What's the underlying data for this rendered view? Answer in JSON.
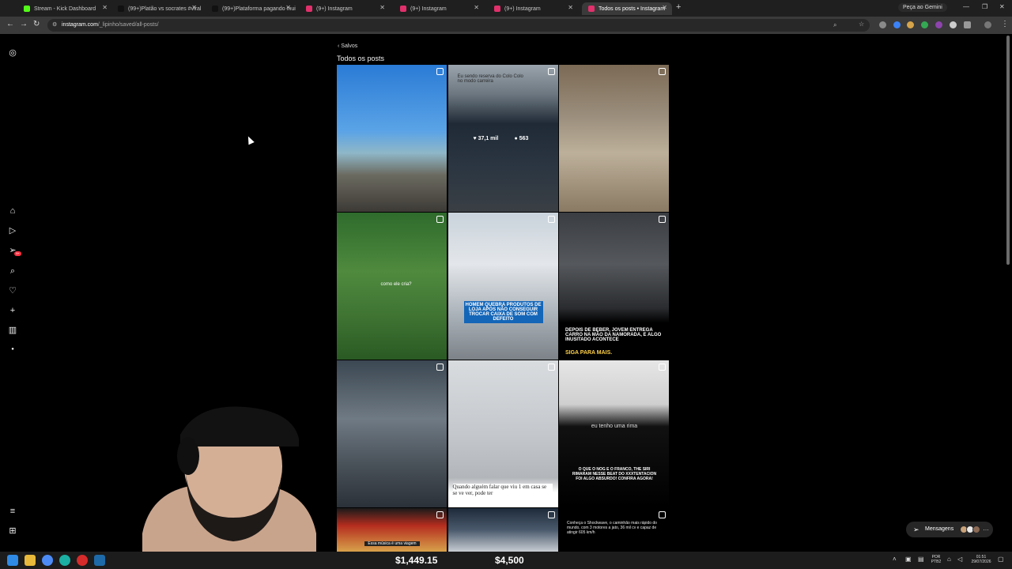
{
  "browser": {
    "tabs": [
      {
        "label": "Stream - Kick Dashboard",
        "color": "#53fc18",
        "active": false
      },
      {
        "label": "(99+)Platão vs socrates #viral #",
        "color": "#111111",
        "active": false
      },
      {
        "label": "(99+)Plataforma pagando muit",
        "color": "#111111",
        "active": false
      },
      {
        "label": "(9+) Instagram",
        "color": "#e1306c",
        "active": false
      },
      {
        "label": "(9+) Instagram",
        "color": "#e1306c",
        "active": false
      },
      {
        "label": "(9+) Instagram",
        "color": "#e1306c",
        "active": false
      },
      {
        "label": "Todos os posts • Instagram",
        "color": "#e1306c",
        "active": true
      }
    ],
    "gemini_label": "Peça ao Gemini",
    "url_host": "instagram.com",
    "url_path": "/_lipinho/saved/all-posts/"
  },
  "instagram": {
    "back_label": "Salvos",
    "page_title": "Todos os posts",
    "notification_badge": "9+",
    "posts": [
      {
        "bg": "linear-gradient(180deg,#2a7bd6 0%,#5aa3e6 45%,#8fb7c8 60%,#6b6a60 75%,#3d3a35 100%)",
        "caption": ""
      },
      {
        "bg": "linear-gradient(180deg,#9aa4ad 0%,#6c7780 20%,#1f2a36 40%,#2b3642 70%,#3a3f44 100%)",
        "caption": "Eu sendo reserva do Colo Colo no modo carreira",
        "likes": "37,1 mil",
        "comments": "563"
      },
      {
        "bg": "linear-gradient(180deg,#7b6a55 0%,#9b8e7c 35%,#bdb09a 60%,#8a7a63 100%)",
        "caption": ""
      },
      {
        "bg": "linear-gradient(180deg,#2f6b2c 0%,#4f8a3e 40%,#3f7433 70%,#2a5a23 100%)",
        "caption": "como ele cria?"
      },
      {
        "bg": "linear-gradient(180deg,#c9d3db 0%,#e3e6ea 35%,#a9b1b8 70%,#7c8288 100%)",
        "caption": "HOMEM QUEBRA PRODUTOS DE LOJA APÓS NÃO CONSEGUIR TROCAR CAIXA DE SOM COM DEFEITO"
      },
      {
        "bg": "linear-gradient(180deg,#3a3d42 0%,#55585c 35%,#2a2c2f 65%,#000000 75%,#000000 100%)",
        "caption": "DEPOIS DE BEBER, JOVEM ENTREGA CARRO NA MÃO DA NAMORADA, E ALGO INUSITADO ACONTECE",
        "caption2": "SIGA PARA MAIS."
      },
      {
        "bg": "linear-gradient(180deg,#3b4752 0%,#6f7a84 40%,#4a525a 70%,#2b3138 100%)",
        "caption": ""
      },
      {
        "bg": "linear-gradient(180deg,#d9dcdf 0%,#c4c8cc 50%,#b2b6ba 80%,#ffffff 90%,#ffffff 100%)",
        "caption": "Quando alguém falar que viu 1 em casa se se ve ver, pode ter"
      },
      {
        "bg": "linear-gradient(180deg,#e6e6e6 0%,#cfcfcf 30%,#111111 45%,#000000 100%)",
        "caption": "eu tenho uma rima",
        "caption2": "O QUE O NOG E O FRANCO, THE SIRI RIMARAM NESSE BEAT DO XXXTENTACION FOI ALGO ABSURDO! CONFIRA AGORA!"
      },
      {
        "bg": "linear-gradient(180deg,#1a1a1a 0%,#b52d1f 40%,#d8a24a 100%)",
        "caption": "Essa música é uma viagem"
      },
      {
        "bg": "linear-gradient(180deg,#1d2a3a 0%,#4a5a6c 50%,#c7ccd2 100%)",
        "caption": ""
      },
      {
        "bg": "linear-gradient(180deg,#000000 0%,#000000 100%)",
        "caption": "Conheça o Shockwave, o caminhão mais rápido do mundo, com 3 motores a jato, 36 mil cv e capaz de atingir 605 km/h"
      }
    ],
    "messages_label": "Mensagens"
  },
  "stream_overlay": {
    "amount_1": "$1,449.15",
    "amount_2": "$4,500",
    "tag": "RA"
  },
  "taskbar": {
    "lang_1": "POR",
    "lang_2": "PTB2",
    "time": "01:51",
    "date": "29/07/2026"
  }
}
